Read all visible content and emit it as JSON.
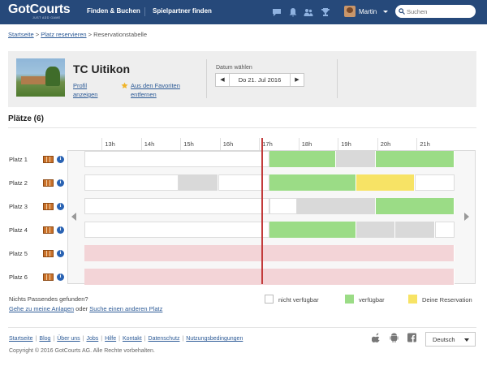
{
  "brand": {
    "name": "GotCourts",
    "tagline": "JUST ADD GAME",
    "color": "#26497a"
  },
  "nav": {
    "links": [
      "Finden & Buchen",
      "Spielpartner finden"
    ],
    "icons": [
      "chat-icon",
      "bell-icon",
      "users-icon",
      "trophy-icon"
    ],
    "username": "Martin",
    "search_placeholder": "Suchen"
  },
  "breadcrumb": {
    "items": [
      "Startseite",
      "Platz reservieren"
    ],
    "current": "Reservationstabelle",
    "separator": ">"
  },
  "club": {
    "name": "TC Uitikon",
    "profile_link": "Profil anzeigen",
    "favorite_link": "Aus den Favoriten entfernen",
    "date_label": "Datum wählen",
    "date_value": "Do 21. Jul 2016",
    "prev_symbol": "◀",
    "next_symbol": "▶"
  },
  "courts": {
    "title": "Plätze (6)",
    "hours": [
      "13h",
      "14h",
      "15h",
      "16h",
      "17h",
      "18h",
      "19h",
      "20h",
      "21h"
    ],
    "names": [
      "Platz 1",
      "Platz 2",
      "Platz 3",
      "Platz 4",
      "Platz 5",
      "Platz 6"
    ],
    "info_symbol": "i"
  },
  "legend": {
    "not_found": "Nichts Passendes gefunden?",
    "link_plants": "Gehe zu meine Anlagen",
    "or": "oder",
    "link_other": "Suche einen anderen Platz",
    "not_available": "nicht verfügbar",
    "available": "verfügbar",
    "my_reservation": "Deine Reservation",
    "colors": {
      "not_available": "#ffffff",
      "available": "#9bdc86",
      "reservation": "#f7e365",
      "booked": "#d9d9d9",
      "closed": "#f3d4d7"
    }
  },
  "footer": {
    "links": [
      "Startseite",
      "Blog",
      "Über uns",
      "Jobs",
      "Hilfe",
      "Kontakt",
      "Datenschutz",
      "Nutzungsbedingungen"
    ],
    "copyright": "Copyright © 2016 GotCourts AG. Alle Rechte vorbehalten.",
    "language": "Deutsch",
    "icons": [
      "apple-icon",
      "android-icon",
      "facebook-icon"
    ]
  }
}
